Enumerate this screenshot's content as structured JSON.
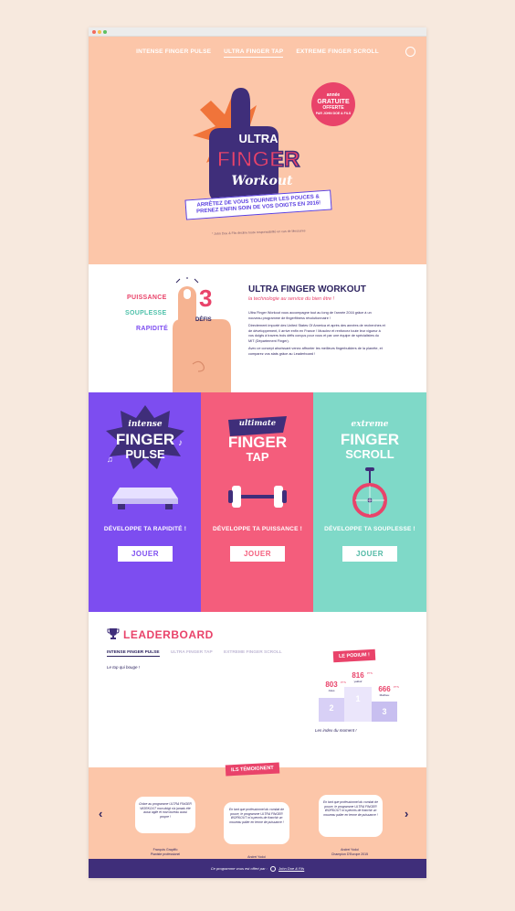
{
  "nav": {
    "items": [
      "INTENSE FINGER PULSE",
      "ULTRA FINGER TAP",
      "EXTREME FINGER SCROLL"
    ],
    "active_index": 1
  },
  "hero": {
    "logo_line1": "ULTRA",
    "logo_line2": "FINGER",
    "logo_line3": "Workout",
    "badge_line1": "année",
    "badge_line2": "GRATUITE",
    "badge_line3": "OFFERTE",
    "badge_line4": "PAR JOHN DOE & FILS",
    "banner_line1": "ARRÊTEZ DE VOUS TOURNER LES POUCES &",
    "banner_line2": "PRENEZ ENFIN SOIN DE VOS DOIGTS EN 2016!",
    "disclaimer": "* John Doe & Fils décline toute responsabilité en cas de blessures"
  },
  "intro": {
    "label_puissance": "PUISSANCE",
    "label_souplesse": "SOUPLESSE",
    "label_rapidite": "RAPIDITÉ",
    "count": "3",
    "defis": "DÉFIS",
    "title": "ULTRA FINGER WORKOUT",
    "subtitle": "la technologie au service du bien être !",
    "p1": "Ultra Finger Workout vous accompagne tout au long de l'année 2016 grâce à un nouveau programme de fingerfitness révolutionnaire !",
    "p2": "Directement importé des United States Of America et après des années de recherches et de développement, il arrive enfin en France ! Musclez et renforcez toute leur vigueur à vos doigts à travers trois défis conçus pour vous et par une équipe de spécialistes du MIT (Département Finger).",
    "p3": "Avec ce concept ahurissant venez affronter les meilleurs fingerbuilders de la planète, et comparez vos stats grâce au Leaderboard !"
  },
  "games": [
    {
      "word_top": "intense",
      "word1": "FINGER",
      "word2": "PULSE",
      "tagline": "DÉVELOPPE TA RAPIDITÉ !",
      "button": "JOUER",
      "color": "#7d4df0"
    },
    {
      "word_top": "ultimate",
      "word1": "FINGER",
      "word2": "TAP",
      "tagline": "DÉVELOPPE TA PUISSANCE !",
      "button": "JOUER",
      "color": "#f45d7c"
    },
    {
      "word_top": "extreme",
      "word1": "FINGER",
      "word2": "SCROLL",
      "tagline": "DÉVELOPPE TA SOUPLESSE !",
      "button": "JOUER",
      "color": "#7fd9c8"
    }
  ],
  "leaderboard": {
    "title": "LEADERBOARD",
    "tabs": [
      "INTENSE FINGER PULSE",
      "ULTRA FINGER TAP",
      "EXTREME FINGER SCROLL"
    ],
    "active_tab": 0,
    "top_text": "Le top qui bouge !",
    "podium_label": "LE PODIUM !",
    "index_text": "Les index du moment !",
    "podium": [
      {
        "rank": "1",
        "score": "816",
        "unit": "PTS",
        "name": "yakkof"
      },
      {
        "rank": "2",
        "score": "803",
        "unit": "PTS",
        "name": "Jules"
      },
      {
        "rank": "3",
        "score": "666",
        "unit": "PTS",
        "name": "Mathieu"
      }
    ]
  },
  "testimonials": {
    "label": "ILS TÉMOIGNENT",
    "items": [
      {
        "quote": "Grâce au programme ULTRA FINGER WORKOUT mon doigt n'a jamais été aussi agile et mon bureau aussi propre !",
        "name": "François Grapiffo",
        "role": "Pianiste professionel"
      },
      {
        "quote": "En tant que professionnel du combat de pouce, le programme ULTRA FINGER WORKOUT m'a permis de franchir un nouveau palier en terme de puissance !",
        "name": "Andrei Yodoi",
        "role": "Champion D'Europe 2015"
      },
      {
        "quote": "En tant que professionnel du combat de pouce, le programme ULTRA FINGER WORKOUT m'a permis de franchir un nouveau palier en terme de puissance !",
        "name": "Andrei Yodoi",
        "role": "Champion D'Europe 2015"
      }
    ]
  },
  "footer": {
    "text": "Ce programme vous est offert par :",
    "brand": "John Doe & Fils"
  },
  "colors": {
    "peach": "#fcc6a9",
    "navy": "#2e2460",
    "pink": "#e9436a",
    "purple": "#7d4df0",
    "coral": "#f45d7c",
    "mint": "#7fd9c8"
  }
}
